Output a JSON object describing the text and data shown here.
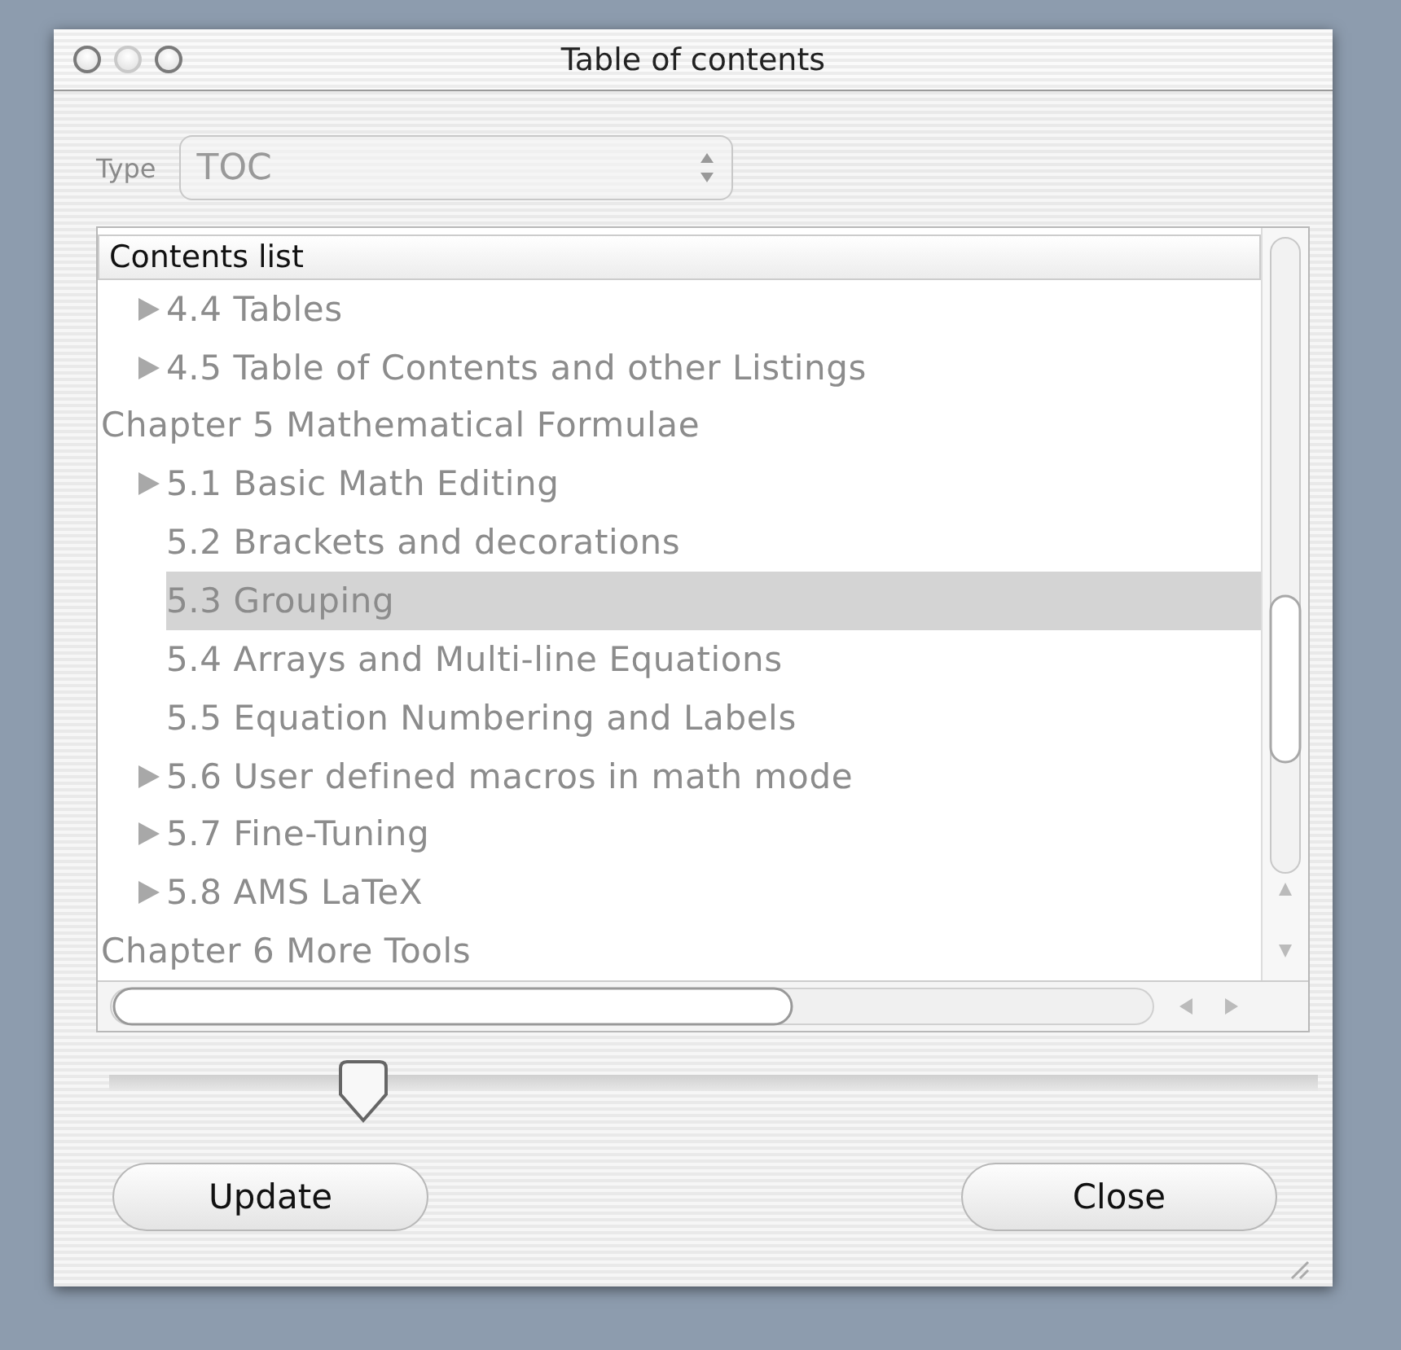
{
  "window": {
    "title": "Table of contents"
  },
  "type_field": {
    "label": "Type",
    "value": "TOC"
  },
  "tree": {
    "header": "Contents list",
    "items": [
      {
        "children": [
          {
            "label": "4.4 Tables",
            "expandable": true,
            "selected": false
          },
          {
            "label": "4.5 Table of Contents and other Listings",
            "expandable": true,
            "selected": false
          }
        ]
      },
      {
        "label": "Chapter 5 Mathematical Formulae",
        "expandable": false,
        "selected": false,
        "children": [
          {
            "label": "5.1 Basic Math Editing",
            "expandable": true,
            "selected": false
          },
          {
            "label": "5.2 Brackets and decorations",
            "expandable": false,
            "selected": false
          },
          {
            "label": "5.3 Grouping",
            "expandable": false,
            "selected": true
          },
          {
            "label": "5.4 Arrays and Multi-line Equations",
            "expandable": false,
            "selected": false
          },
          {
            "label": "5.5 Equation Numbering and Labels",
            "expandable": false,
            "selected": false
          },
          {
            "label": "5.6 User defined macros in math mode",
            "expandable": true,
            "selected": false
          },
          {
            "label": "5.7 Fine-Tuning",
            "expandable": true,
            "selected": false
          },
          {
            "label": "5.8 AMS LaTeX",
            "expandable": true,
            "selected": false
          }
        ]
      },
      {
        "label": "Chapter 6 More Tools",
        "expandable": false,
        "selected": false
      }
    ]
  },
  "level_slider": {
    "level": 0.21
  },
  "buttons": [
    {
      "label": "Update"
    },
    {
      "label": "Close"
    }
  ]
}
